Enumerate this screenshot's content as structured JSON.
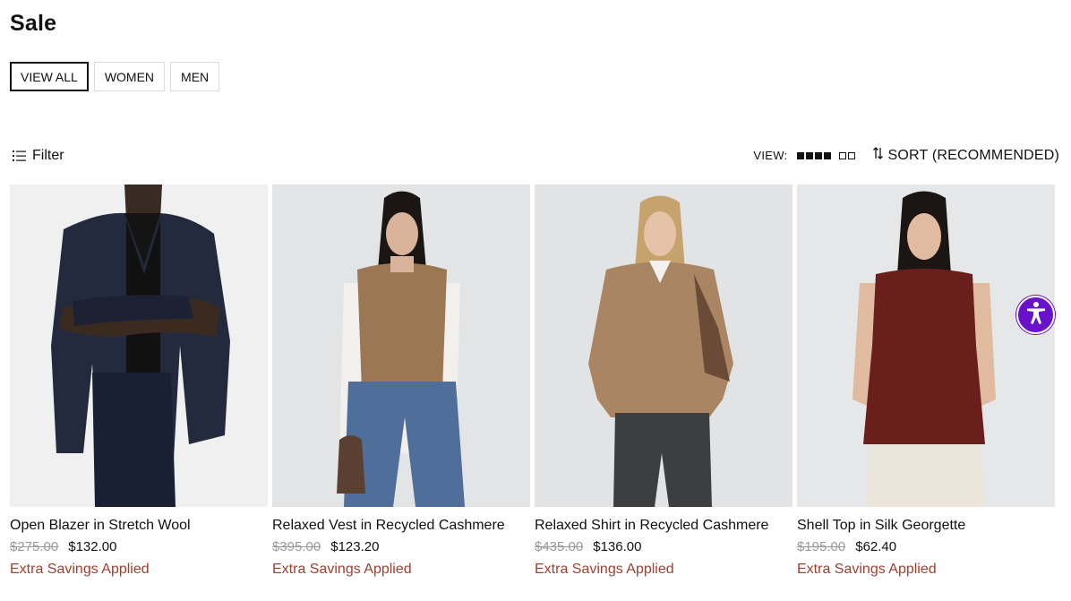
{
  "page": {
    "title": "Sale"
  },
  "categories": [
    {
      "label": "VIEW ALL",
      "active": true
    },
    {
      "label": "WOMEN",
      "active": false
    },
    {
      "label": "MEN",
      "active": false
    }
  ],
  "toolbar": {
    "filter_label": "Filter",
    "view_label": "VIEW:",
    "sort_label": "SORT (RECOMMENDED)"
  },
  "products": [
    {
      "name": "Open Blazer in Stretch Wool",
      "original_price": "$275.00",
      "sale_price": "$132.00",
      "promo": "Extra Savings Applied"
    },
    {
      "name": "Relaxed Vest in Recycled Cashmere",
      "original_price": "$395.00",
      "sale_price": "$123.20",
      "promo": "Extra Savings Applied"
    },
    {
      "name": "Relaxed Shirt in Recycled Cashmere",
      "original_price": "$435.00",
      "sale_price": "$136.00",
      "promo": "Extra Savings Applied"
    },
    {
      "name": "Shell Top in Silk Georgette",
      "original_price": "$195.00",
      "sale_price": "$62.40",
      "promo": "Extra Savings Applied"
    }
  ],
  "colors": {
    "promo": "#a0402f",
    "accessibility": "#6a11cb",
    "text": "#111111"
  },
  "icons": [
    "filter-icon",
    "grid-4-icon",
    "grid-2-icon",
    "sort-icon",
    "accessibility-icon"
  ]
}
